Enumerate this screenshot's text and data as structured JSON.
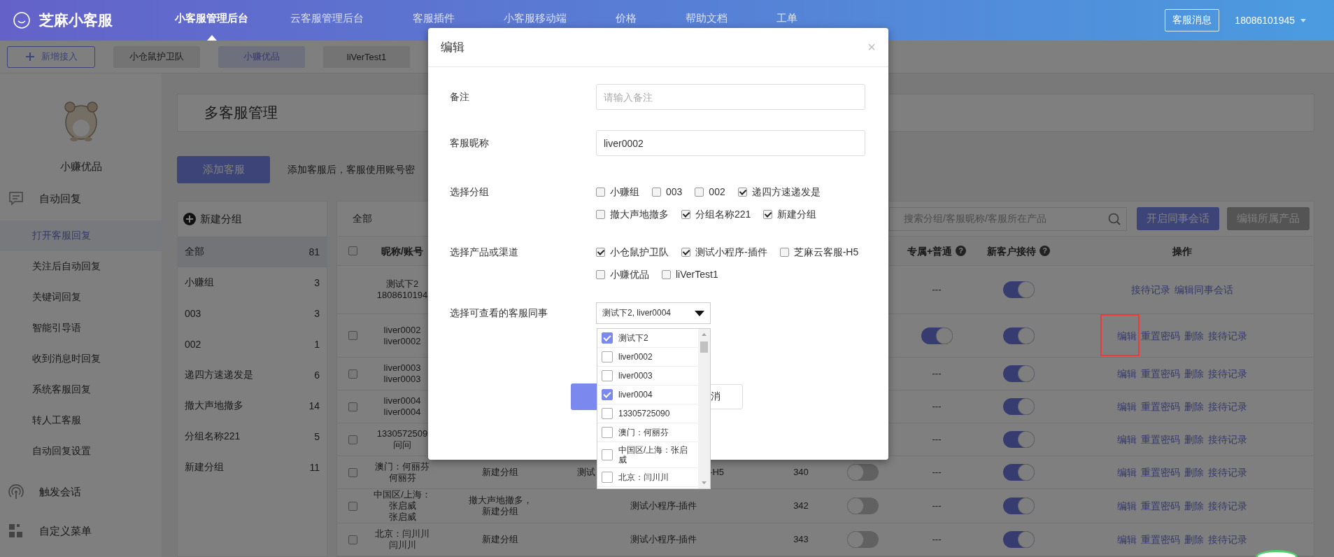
{
  "top_bar": {
    "brand": "芝麻小客服",
    "nav": [
      {
        "label": "小客服管理后台",
        "selected": true
      },
      {
        "label": "云客服管理后台",
        "selected": false
      },
      {
        "label": "客服插件",
        "selected": false
      },
      {
        "label": "小客服移动端",
        "selected": false
      },
      {
        "label": "价格",
        "selected": false
      },
      {
        "label": "帮助文档",
        "selected": false
      },
      {
        "label": "工单",
        "selected": false
      }
    ],
    "message_button": "客服消息",
    "account": "18086101945"
  },
  "shop_bar": {
    "add_button": "新增接入",
    "shops": [
      {
        "label": "小仓鼠护卫队",
        "selected": false
      },
      {
        "label": "小赚优品",
        "selected": true
      },
      {
        "label": "liVerTest1",
        "selected": false
      }
    ]
  },
  "sidebar": {
    "shop_name": "小赚优品",
    "sections": [
      {
        "title": "自动回复",
        "kind": "chat",
        "items": [
          {
            "label": "打开客服回复",
            "selected": true
          },
          {
            "label": "关注后自动回复",
            "selected": false
          },
          {
            "label": "关键词回复",
            "selected": false
          },
          {
            "label": "智能引导语",
            "selected": false
          },
          {
            "label": "收到消息时回复",
            "selected": false
          },
          {
            "label": "系统客服回复",
            "selected": false
          },
          {
            "label": "转人工客服",
            "selected": false
          },
          {
            "label": "自动回复设置",
            "selected": false
          }
        ]
      },
      {
        "title": "触发会话",
        "kind": "signal"
      },
      {
        "title": "自定义菜单",
        "kind": "grid"
      }
    ]
  },
  "page": {
    "title": "多客服管理",
    "add_button": "添加客服",
    "hint": "添加客服后，客服使用账号密"
  },
  "groups": {
    "new_button": "新建分组",
    "items": [
      {
        "name": "全部",
        "count": "81",
        "selected": true
      },
      {
        "name": "小赚组",
        "count": "3",
        "selected": false
      },
      {
        "name": "003",
        "count": "3",
        "selected": false
      },
      {
        "name": "002",
        "count": "1",
        "selected": false
      },
      {
        "name": "递四方速递发是",
        "count": "6",
        "selected": false
      },
      {
        "name": "撤大声地撤多",
        "count": "14",
        "selected": false
      },
      {
        "name": "分组名称221",
        "count": "5",
        "selected": false
      },
      {
        "name": "新建分组",
        "count": "11",
        "selected": false
      }
    ]
  },
  "table": {
    "current_group": "全部",
    "search": {
      "placeholder": "搜索分组/客服昵称/客服所在产品"
    },
    "buttons": [
      {
        "label": "开启同事会话",
        "disabled": false
      },
      {
        "label": "编辑所属产品",
        "disabled": true
      }
    ],
    "header": {
      "select_all_checked": false,
      "nickname": "昵称/账号",
      "exclusive": {
        "label": "专属+普通",
        "help": "?"
      },
      "new_customer": {
        "label": "新客户接待",
        "help": "?"
      },
      "actions": "操作"
    },
    "rows": [
      {
        "nickname": [
          "测试下2",
          "1808610194"
        ],
        "exclusive": {
          "kind": "text",
          "text": "---"
        },
        "new_customer": {
          "on": true
        },
        "actions": [
          "接待记录",
          "编辑同事会话"
        ],
        "annotated": false
      },
      {
        "checked": false,
        "nickname": [
          "liver0002",
          "liver0002"
        ],
        "exclusive": {
          "kind": "toggle",
          "on": true
        },
        "new_customer": {
          "on": true
        },
        "actions": [
          "编辑",
          "重置密码",
          "删除",
          "接待记录"
        ],
        "annotated": true
      },
      {
        "checked": false,
        "nickname": [
          "liver0003",
          "liver0003"
        ],
        "exclusive": {
          "kind": "text",
          "text": "---"
        },
        "new_customer": {
          "on": true
        },
        "actions": [
          "编辑",
          "重置密码",
          "删除",
          "接待记录"
        ],
        "annotated": false
      },
      {
        "checked": false,
        "nickname": [
          "liver0004",
          "liver0004"
        ],
        "exclusive": {
          "kind": "text",
          "text": "---"
        },
        "new_customer": {
          "on": true
        },
        "actions": [
          "编辑",
          "重置密码",
          "删除",
          "接待记录"
        ],
        "annotated": false
      },
      {
        "checked": false,
        "nickname": [
          "1330572509",
          "问问"
        ],
        "exclusive": {
          "kind": "text",
          "text": "---"
        },
        "new_customer": {
          "on": true
        },
        "actions": [
          "编辑",
          "重置密码",
          "删除",
          "接待记录"
        ],
        "annotated": false
      },
      {
        "checked": false,
        "nickname": [
          "澳门：何丽芬",
          "何丽芬"
        ],
        "column_3": "新建分组",
        "column_4": [
          "测试",
          "-H5"
        ],
        "column_5": "340",
        "column_6": {
          "on": false
        },
        "exclusive": {
          "kind": "text",
          "text": "---"
        },
        "new_customer": {
          "on": true
        },
        "actions": [
          "编辑",
          "重置密码",
          "删除",
          "接待记录"
        ],
        "annotated": false
      },
      {
        "checked": false,
        "nickname": [
          "中国区/上海：",
          "张启威",
          "张启威"
        ],
        "column_3": "撤大声地撤多，新建分组",
        "column_4": "测试小程序-插件",
        "column_5": "342",
        "column_6": {
          "on": false
        },
        "exclusive": {
          "kind": "text",
          "text": "---"
        },
        "new_customer": {
          "on": true
        },
        "actions": [
          "编辑",
          "重置密码",
          "删除",
          "接待记录"
        ],
        "annotated": false
      },
      {
        "checked": false,
        "nickname": [
          "北京：闫川川",
          "闫川川"
        ],
        "column_3": "新建分组",
        "column_4": "测试小程序-插件",
        "column_5": "343",
        "column_6": {
          "on": false
        },
        "exclusive": {
          "kind": "text",
          "text": "---"
        },
        "new_customer": {
          "on": true
        },
        "actions": [
          "编辑",
          "重置密码",
          "删除",
          "接待记录"
        ],
        "annotated": false
      }
    ]
  },
  "modal": {
    "title": "编辑",
    "close": "×",
    "fields": [
      {
        "kind": "text",
        "label": "备注",
        "placeholder": "请输入备注"
      },
      {
        "kind": "text",
        "label": "客服昵称",
        "value": "liver0002"
      },
      {
        "kind": "checks",
        "label": "选择分组",
        "options": [
          {
            "label": "小赚组",
            "checked": false
          },
          {
            "label": "003",
            "checked": false
          },
          {
            "label": "002",
            "checked": false
          },
          {
            "label": "递四方速递发是",
            "checked": true
          },
          {
            "label": "撤大声地撤多",
            "checked": false
          },
          {
            "label": "分组名称221",
            "checked": true
          },
          {
            "label": "新建分组",
            "checked": true
          }
        ]
      },
      {
        "kind": "checks",
        "label": "选择产品或渠道",
        "options": [
          {
            "label": "小仓鼠护卫队",
            "checked": true
          },
          {
            "label": "测试小程序-插件",
            "checked": true
          },
          {
            "label": "芝麻云客服-H5",
            "checked": false
          },
          {
            "label": "小赚优品",
            "checked": false
          },
          {
            "label": "liVerTest1",
            "checked": false
          }
        ]
      },
      {
        "kind": "multiselect",
        "label": "选择可查看的客服同事",
        "value": "测试下2, liver0004",
        "options": [
          {
            "label": "测试下2",
            "checked": true
          },
          {
            "label": "liver0002",
            "checked": false
          },
          {
            "label": "liver0003",
            "checked": false
          },
          {
            "label": "liver0004",
            "checked": true
          },
          {
            "label": "13305725090",
            "checked": false
          },
          {
            "label": "澳门：何丽芬",
            "checked": false
          },
          {
            "label": "中国区/上海：张启威",
            "checked": false
          },
          {
            "label": "北京：闫川川",
            "checked": false
          }
        ]
      }
    ],
    "buttons": [
      {
        "kind": "primary"
      },
      {
        "kind": "default",
        "label": "消"
      }
    ]
  }
}
